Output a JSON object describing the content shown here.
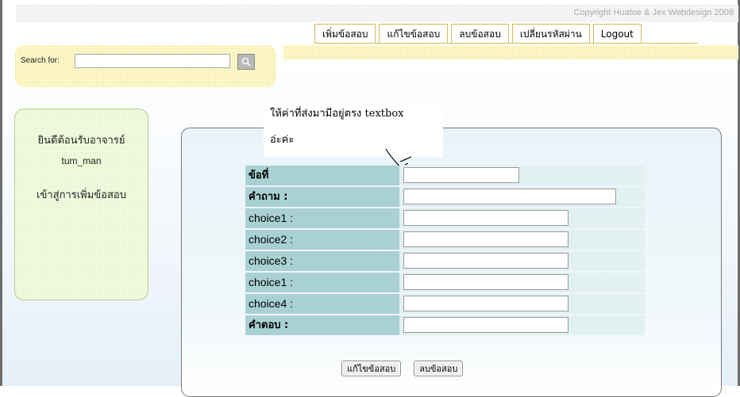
{
  "header": {
    "copyright": "Copyright  Huatoe & Jex Webdesign 2008"
  },
  "nav": {
    "tabs": [
      "เพิ่มข้อสอบ",
      "แก้ไขข้อสอบ",
      "ลบข้อสอบ",
      "เปลี่ยนรหัสผ่าน",
      "Logout"
    ]
  },
  "search": {
    "label": "Search for:",
    "value": "",
    "button_icon": "magnifier-icon"
  },
  "sidebar": {
    "welcome": "ยินดีต้อนรับอาจารย์",
    "username": "tum_man",
    "link": "เข้าสู่การเพิ่มข้อสอบ"
  },
  "note": {
    "line1": "ให้ค่าที่ส่งมามีอยู่ตรง textbox",
    "line2": "อ่ะค่ะ"
  },
  "form": {
    "rows": [
      {
        "label": "ข้อที่",
        "value": ""
      },
      {
        "label": "คำถาม :",
        "value": ""
      },
      {
        "label": "choice1 :",
        "value": ""
      },
      {
        "label": "choice2 :",
        "value": ""
      },
      {
        "label": "choice3 :",
        "value": ""
      },
      {
        "label": "choice1 :",
        "value": ""
      },
      {
        "label": "choice4 :",
        "value": ""
      },
      {
        "label": "คำตอบ :",
        "value": ""
      }
    ],
    "edit_button": "แก้ไขข้อสอบ",
    "delete_button": "ลบข้อสอบ"
  }
}
